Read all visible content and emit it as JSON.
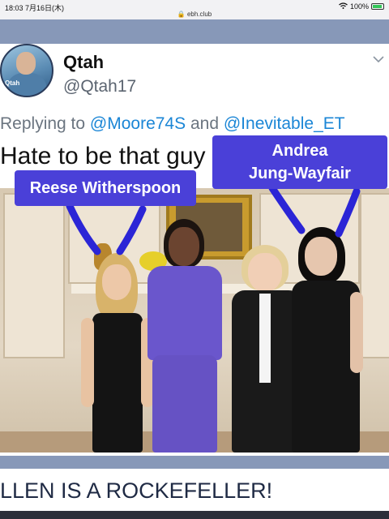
{
  "status_bar": {
    "time_date": "18:03 7月16日(木)",
    "url": "ebh.club",
    "battery": "100%"
  },
  "tweet": {
    "avatar_tag": "Qtah",
    "name": "Qtah",
    "handle": "@Qtah17",
    "reply_prefix": "Replying to",
    "reply_mention_1": "@Moore74S",
    "reply_and": "and",
    "reply_mention_2": "@Inevitable_ET",
    "text": "Hate to be that guy"
  },
  "image": {
    "label_left": "Reese Witherspoon",
    "label_right_line1": "Andrea",
    "label_right_line2": "Jung-Wayfair",
    "accent_color": "#4a40d8",
    "arrow_color": "#2b25d6"
  },
  "page": {
    "headline": "LLEN IS A ROCKEFELLER!"
  },
  "icons": {
    "lock": "lock-icon",
    "wifi": "wifi-icon",
    "battery": "battery-icon",
    "chevron": "chevron-down-icon"
  }
}
